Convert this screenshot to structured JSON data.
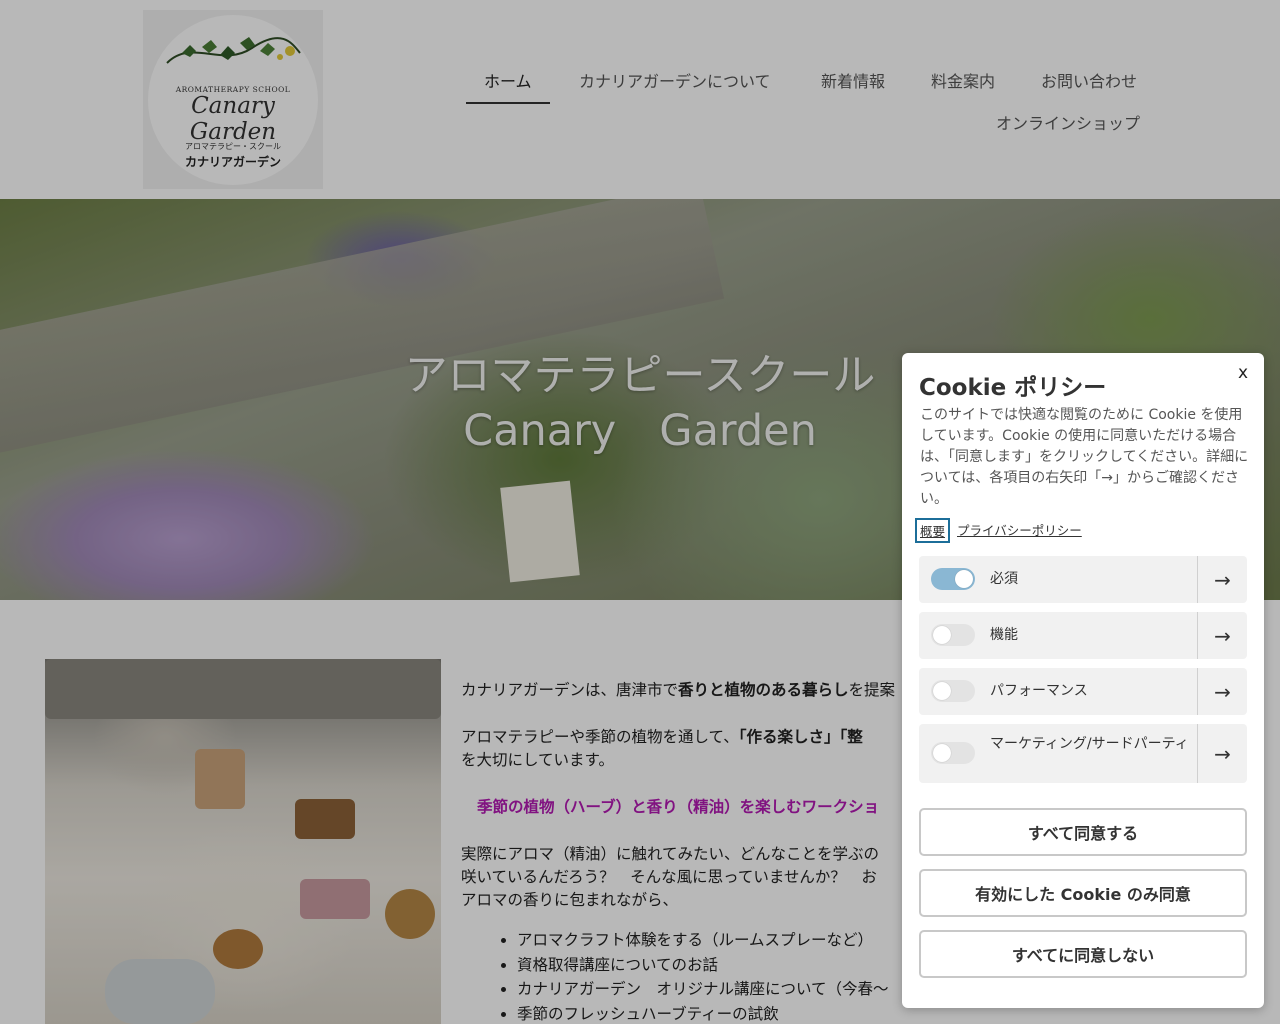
{
  "logo": {
    "sub": "AROMATHERAPY SCHOOL",
    "main": "Canary Garden",
    "jp_small": "アロマテラピー・スクール",
    "jp_main": "カナリアガーデン"
  },
  "nav": {
    "items": [
      "ホーム",
      "カナリアガーデンについて",
      "新着情報",
      "料金案内",
      "お問い合わせ",
      "オンラインショップ"
    ]
  },
  "hero": {
    "line1": "アロマテラピースクール",
    "line2": "Canary　Garden"
  },
  "content": {
    "p1_pre": "カナリアガーデンは、唐津市で",
    "p1_bold": "香りと植物のある暮らし",
    "p1_post": "を提案",
    "p2_pre": "アロマテラピーや季節の植物を通して、",
    "p2_bold": "「作る楽しさ」「整",
    "p2_line2": "を大切にしています。",
    "highlight": "季節の植物（ハーブ）と香り（精油）を楽しむワークショ",
    "p3_line1": "実際にアロマ（精油）に触れてみたい、どんなことを学ぶの",
    "p3_line2": "咲いているんだろう？　そんな風に思っていませんか？　お",
    "p3_line3": "アロマの香りに包まれながら、",
    "list": [
      "アロマクラフト体験をする（ルームスプレーなど）",
      "資格取得講座についてのお話",
      "カナリアガーデン　オリジナル講座について（今春～",
      "季節のフレッシュハーブティーの試飲"
    ]
  },
  "cookie": {
    "close": "x",
    "title": "Cookie ポリシー",
    "description": "このサイトでは快適な閲覧のために Cookie を使用しています。Cookie の使用に同意いただける場合は、「同意します」をクリックしてください。詳細については、各項目の右矢印「→」からご確認ください。",
    "tabs": [
      "概要",
      "プライバシーポリシー"
    ],
    "categories": [
      {
        "label": "必須",
        "enabled": true
      },
      {
        "label": "機能",
        "enabled": false
      },
      {
        "label": "パフォーマンス",
        "enabled": false
      },
      {
        "label": "マーケティング/サードパーティ",
        "enabled": false
      }
    ],
    "arrow": "→",
    "buttons": {
      "accept_all": "すべて同意する",
      "accept_selected": "有効にした Cookie のみ同意",
      "reject_all": "すべてに同意しない"
    }
  },
  "colors": {
    "highlight": "#b31ab3",
    "toggle_on": "#8ab7d3",
    "tab_focus": "#1c6e99"
  }
}
